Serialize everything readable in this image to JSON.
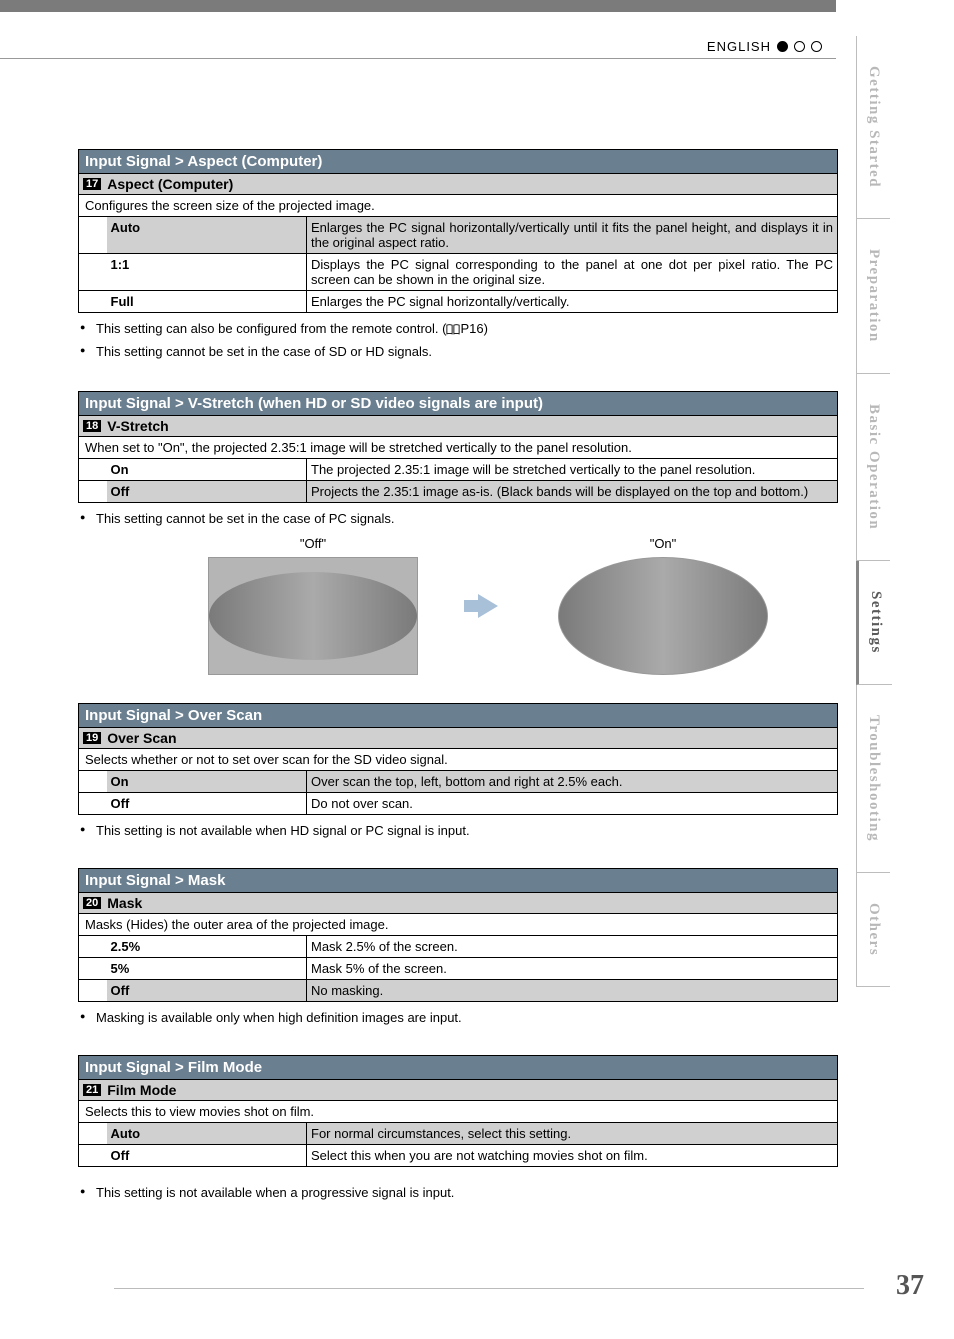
{
  "header": {
    "lang": "ENGLISH"
  },
  "tabs": [
    "Getting Started",
    "Preparation",
    "Basic Operation",
    "Settings",
    "Troubleshooting",
    "Others"
  ],
  "active_tab": 3,
  "page_number": "37",
  "sections": [
    {
      "breadcrumb": "Input Signal > Aspect (Computer)",
      "num": "17",
      "title": "Aspect (Computer)",
      "desc": "Configures the screen size of the projected image.",
      "rows": [
        {
          "label": "Auto",
          "text": "Enlarges the PC signal horizontally/vertically until it fits the panel height, and displays it in the original aspect ratio.",
          "hl": true
        },
        {
          "label": "1:1",
          "text": "Displays the PC signal corresponding to the panel at one dot per pixel ratio. The PC screen can be shown in the original size.",
          "hl": false
        },
        {
          "label": "Full",
          "text": "Enlarges the PC signal horizontally/vertically.",
          "hl": false
        }
      ],
      "notes": [
        "This setting can also be configured from the remote control. (",
        "This setting cannot be set in the case of SD or HD signals."
      ],
      "note0_ref": "P16)"
    },
    {
      "breadcrumb": "Input Signal > V-Stretch (when HD or SD video signals are input)",
      "num": "18",
      "title": "V-Stretch",
      "desc": "When set to \"On\", the projected 2.35:1 image will be stretched vertically to the panel resolution.",
      "rows": [
        {
          "label": "On",
          "text": "The projected 2.35:1 image will be stretched vertically to the panel resolution.",
          "hl": false
        },
        {
          "label": "Off",
          "text": "Projects the 2.35:1 image as-is. (Black bands will be displayed on the top and bottom.)",
          "hl": true
        }
      ],
      "notes": [
        "This setting cannot be set in the case of PC signals."
      ],
      "fig_labels": {
        "off": "\"Off\"",
        "on": "\"On\""
      }
    },
    {
      "breadcrumb": "Input Signal > Over Scan",
      "num": "19",
      "title": "Over Scan",
      "desc": "Selects whether or not to set over scan for the SD video signal.",
      "rows": [
        {
          "label": "On",
          "text": "Over scan the top, left, bottom and right at 2.5% each.",
          "hl": true
        },
        {
          "label": "Off",
          "text": "Do not over scan.",
          "hl": false
        }
      ],
      "notes": [
        "This setting is not available when HD signal or PC signal is input."
      ]
    },
    {
      "breadcrumb": "Input Signal > Mask",
      "num": "20",
      "title": "Mask",
      "desc": "Masks (Hides) the outer area of the projected image.",
      "rows": [
        {
          "label": "2.5%",
          "text": "Mask 2.5% of the screen.",
          "hl": false
        },
        {
          "label": "5%",
          "text": "Mask 5% of the screen.",
          "hl": false
        },
        {
          "label": "Off",
          "text": "No masking.",
          "hl": true
        }
      ],
      "notes": [
        "Masking is available only when high definition images are input."
      ]
    },
    {
      "breadcrumb": "Input Signal > Film Mode",
      "num": "21",
      "title": "Film Mode",
      "desc": "Selects this to view movies shot on film.",
      "rows": [
        {
          "label": "Auto",
          "text": "For normal circumstances, select this setting.",
          "hl": true
        },
        {
          "label": "Off",
          "text": "Select this when you are not watching movies shot on film.",
          "hl": false
        }
      ],
      "notes": [
        "This setting is not available when a progressive signal is input."
      ]
    }
  ]
}
